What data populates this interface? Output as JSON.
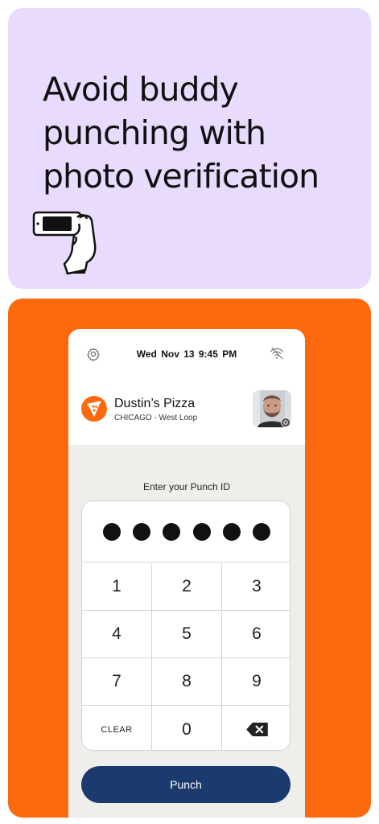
{
  "promo": {
    "headline_line1": "Avoid buddy",
    "headline_line2": "punching with",
    "headline_line3": "photo verification",
    "icon": "hand-holding-phone-icon",
    "background": "#e8dbfd"
  },
  "device": {
    "background": "#fd6a0e",
    "datetime": "Wed Nov 13  9:45 PM",
    "settings_icon": "gear-icon",
    "status_icon": "wifi-off-icon",
    "store": {
      "name": "Dustin’s Pizza",
      "location": "CHICAGO - West Loop",
      "logo_icon": "pizza-slice-icon"
    },
    "avatar_badge_icon": "camera-icon",
    "punch_id_label": "Enter your Punch ID",
    "pin_dots": 6,
    "keys": [
      "1",
      "2",
      "3",
      "4",
      "5",
      "6",
      "7",
      "8",
      "9",
      "CLEAR",
      "0"
    ],
    "backspace_icon": "backspace-icon",
    "punch_button_label": "Punch",
    "button_color": "#1b3a6e"
  }
}
